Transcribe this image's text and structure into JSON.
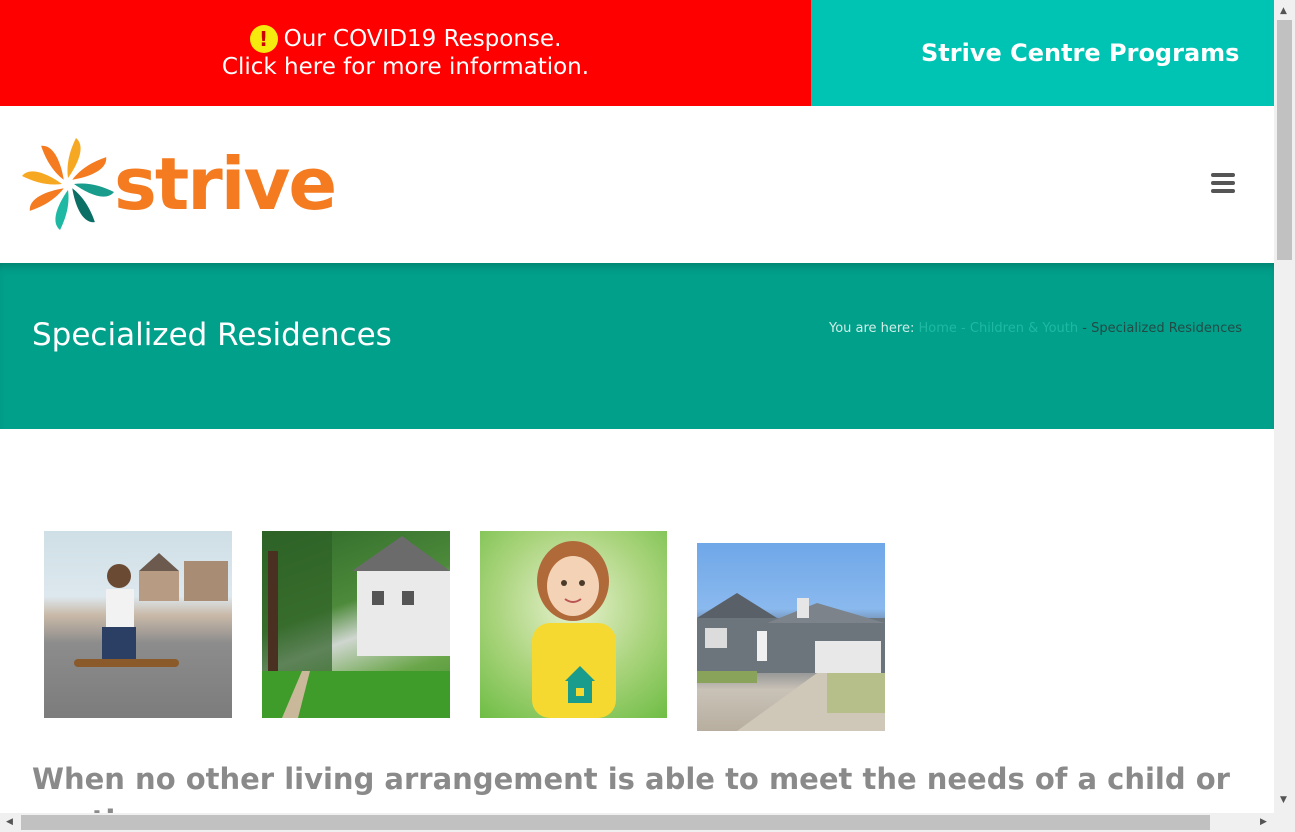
{
  "banner": {
    "covid_line1": "Our COVID19 Response.",
    "covid_line2": "Click here for more information.",
    "warning_icon": "exclamation-icon",
    "covid_color": "#ff0000",
    "programs_label": "Strive Centre Programs",
    "programs_color": "#00c4b3"
  },
  "header": {
    "logo_text": "strive",
    "logo_color": "#f47b20",
    "menu_icon": "hamburger-menu-icon"
  },
  "title_bar": {
    "title": "Specialized Residences",
    "color": "#00a08b",
    "breadcrumb": {
      "prefix": "You are here:",
      "home": "Home",
      "sep": "-",
      "parent": "Children & Youth",
      "current": "Specialized Residences"
    }
  },
  "gallery": {
    "images": [
      {
        "name": "girl-with-skateboard-photo"
      },
      {
        "name": "tree-lined-street-photo"
      },
      {
        "name": "girl-holding-house-photo"
      },
      {
        "name": "suburban-house-photo"
      }
    ]
  },
  "intro": {
    "text": "When no other living arrangement is able to meet the needs of a child or youth,"
  }
}
